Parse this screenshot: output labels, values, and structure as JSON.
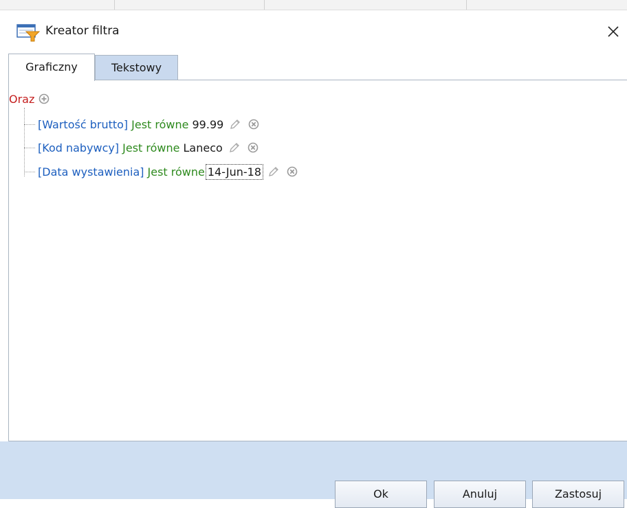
{
  "dialog": {
    "title": "Kreator filtra",
    "icons": {
      "app": "filter-wizard-icon",
      "close": "close-icon"
    }
  },
  "tabs": [
    {
      "label": "Graficzny",
      "active": true
    },
    {
      "label": "Tekstowy",
      "active": false
    }
  ],
  "filter": {
    "root": {
      "label": "Oraz",
      "add_icon": "add-condition-icon"
    },
    "conditions": [
      {
        "field": "[Wartość brutto]",
        "operator": "Jest równe",
        "value": "99.99"
      },
      {
        "field": "[Kod nabywcy]",
        "operator": "Jest równe",
        "value": "Laneco"
      },
      {
        "field": "[Data wystawienia]",
        "operator": "Jest równe",
        "value": "14-Jun-18",
        "focused": true
      }
    ],
    "row_icons": {
      "edit": "pencil-icon",
      "remove": "remove-icon"
    }
  },
  "buttons": {
    "ok": "Ok",
    "cancel": "Anuluj",
    "apply": "Zastosuj"
  },
  "colors": {
    "root_label": "#c41f1f",
    "field": "#1d5fbf",
    "operator": "#2e8a1e",
    "footer": "#cfdff2",
    "inactive_tab": "#c9d9ee"
  }
}
